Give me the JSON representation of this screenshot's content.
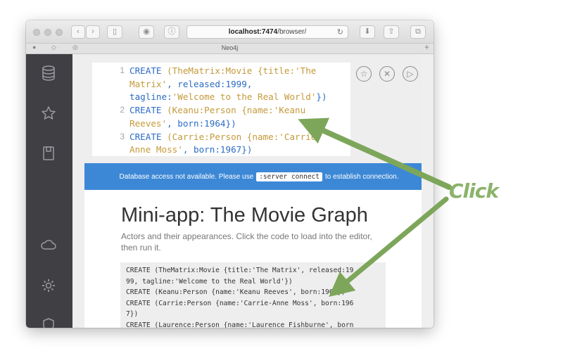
{
  "browser": {
    "url_host": "localhost:7474",
    "url_path": "/browser/",
    "tab_title": "Neo4j"
  },
  "sidebar": {
    "items": [
      {
        "icon": "database-icon"
      },
      {
        "icon": "star-icon"
      },
      {
        "icon": "document-icon"
      },
      {
        "icon": "cloud-icon"
      },
      {
        "icon": "gear-icon"
      },
      {
        "icon": "shield-icon"
      }
    ]
  },
  "editor": {
    "lines": [
      {
        "num": "1",
        "parts": [
          [
            "kw",
            "CREATE "
          ],
          [
            "st",
            "(TheMatrix:Movie {title:'The"
          ]
        ]
      },
      {
        "num": "",
        "parts": [
          [
            "st",
            "Matrix'"
          ],
          [
            "kw",
            ", released:1999,"
          ]
        ]
      },
      {
        "num": "",
        "parts": [
          [
            "kw",
            "tagline:"
          ],
          [
            "st",
            "'Welcome to the Real World'"
          ],
          [
            "kw",
            "})"
          ]
        ]
      },
      {
        "num": "2",
        "parts": [
          [
            "kw",
            "CREATE "
          ],
          [
            "st",
            "(Keanu:Person {name:'Keanu"
          ]
        ]
      },
      {
        "num": "",
        "parts": [
          [
            "st",
            "Reeves'"
          ],
          [
            "kw",
            ", born:1964})"
          ]
        ]
      },
      {
        "num": "3",
        "parts": [
          [
            "kw",
            "CREATE "
          ],
          [
            "st",
            "(Carrie:Person {name:'Carrie-"
          ]
        ]
      },
      {
        "num": "",
        "parts": [
          [
            "st",
            "Anne Moss'"
          ],
          [
            "kw",
            ", born:1967})"
          ]
        ]
      }
    ],
    "controls": [
      {
        "name": "favorite-star-button",
        "glyph": "☆"
      },
      {
        "name": "clear-x-button",
        "glyph": "✕"
      },
      {
        "name": "run-play-button",
        "glyph": "▷"
      }
    ]
  },
  "banner": {
    "text_before": "Database access not available. Please use",
    "command": ":server connect",
    "text_after": "to establish connection."
  },
  "guide": {
    "title": "Mini-app: The Movie Graph",
    "subtitle": "Actors and their appearances. Click the code to load into the editor, then run it.",
    "code_lines": [
      "CREATE (TheMatrix:Movie {title:'The Matrix', released:19",
      "99, tagline:'Welcome to the Real World'})",
      "CREATE (Keanu:Person {name:'Keanu Reeves', born:1964})",
      "CREATE (Carrie:Person {name:'Carrie-Anne Moss', born:196",
      "7})",
      "CREATE (Laurence:Person {name:'Laurence Fishburne', born"
    ]
  },
  "annotation": {
    "label": "Click",
    "color": "#8bb36b"
  },
  "colors": {
    "sidebar_bg": "#3f3f44",
    "banner_bg": "#3d88d6",
    "keyword": "#2c6cc5",
    "string": "#c49a3a"
  }
}
